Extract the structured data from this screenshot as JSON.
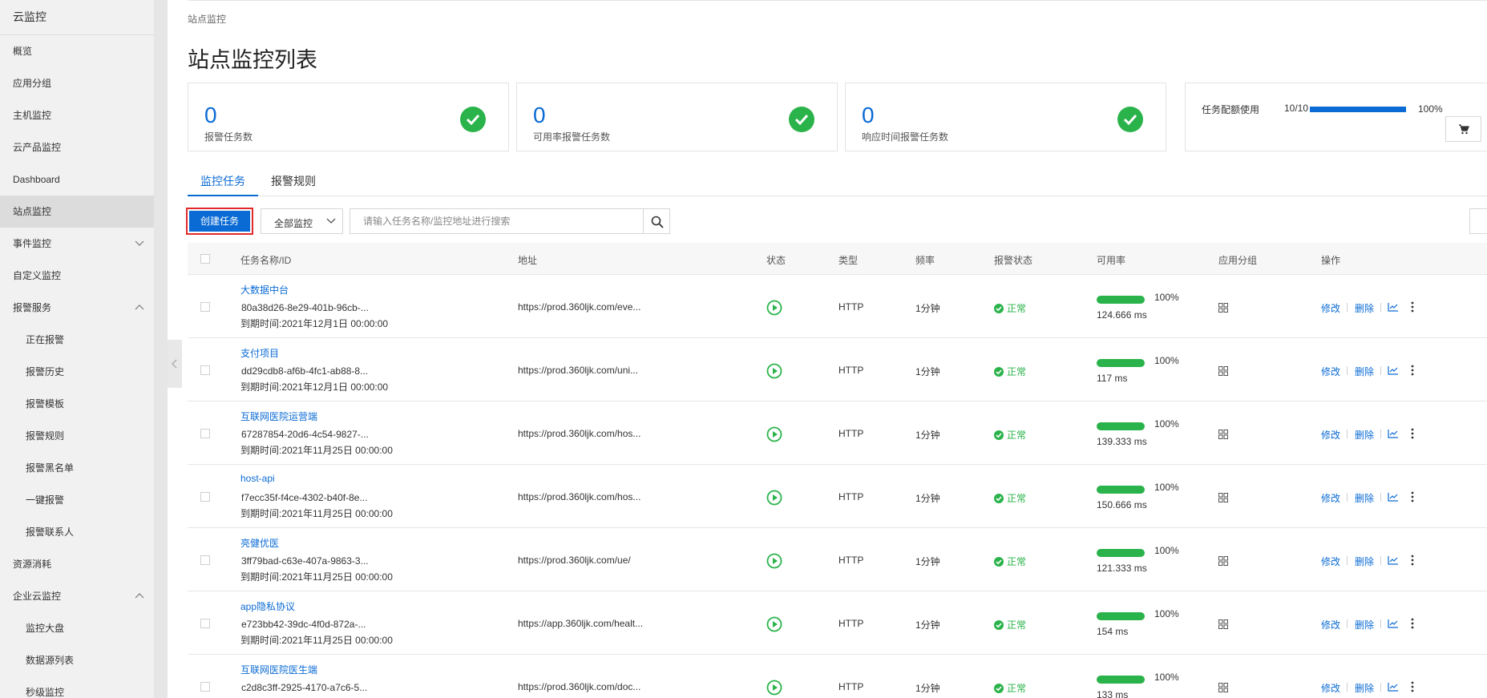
{
  "sidebar": {
    "title": "云监控",
    "items": [
      {
        "label": "概览",
        "sub": false
      },
      {
        "label": "应用分组",
        "sub": false
      },
      {
        "label": "主机监控",
        "sub": false
      },
      {
        "label": "云产品监控",
        "sub": false
      },
      {
        "label": "Dashboard",
        "sub": false
      },
      {
        "label": "站点监控",
        "sub": false,
        "active": true
      },
      {
        "label": "事件监控",
        "sub": false,
        "chevron": "down"
      },
      {
        "label": "自定义监控",
        "sub": false
      },
      {
        "label": "报警服务",
        "sub": false,
        "chevron": "up"
      },
      {
        "label": "正在报警",
        "sub": true
      },
      {
        "label": "报警历史",
        "sub": true
      },
      {
        "label": "报警模板",
        "sub": true
      },
      {
        "label": "报警规则",
        "sub": true
      },
      {
        "label": "报警黑名单",
        "sub": true
      },
      {
        "label": "一键报警",
        "sub": true
      },
      {
        "label": "报警联系人",
        "sub": true
      },
      {
        "label": "资源消耗",
        "sub": false
      },
      {
        "label": "企业云监控",
        "sub": false,
        "chevron": "up"
      },
      {
        "label": "监控大盘",
        "sub": true
      },
      {
        "label": "数据源列表",
        "sub": true
      },
      {
        "label": "秒级监控",
        "sub": true
      }
    ]
  },
  "breadcrumb": "站点监控",
  "page_title": "站点监控列表",
  "stats": [
    {
      "value": "0",
      "label": "报警任务数"
    },
    {
      "value": "0",
      "label": "可用率报警任务数"
    },
    {
      "value": "0",
      "label": "响应时间报警任务数"
    }
  ],
  "quota": {
    "label": "任务配额使用",
    "count": "10/10",
    "percent": "100%",
    "fill": 1.0
  },
  "tabs": [
    "监控任务",
    "报警规则"
  ],
  "toolbar": {
    "create_label": "创建任务",
    "filter_value": "全部监控",
    "search_placeholder": "请输入任务名称/监控地址进行搜索"
  },
  "table": {
    "headers": {
      "name": "任务名称/ID",
      "address": "地址",
      "status": "状态",
      "type": "类型",
      "freq": "频率",
      "alarm": "报警状态",
      "availability": "可用率",
      "group": "应用分组",
      "ops": "操作"
    },
    "rows": [
      {
        "name": "大数据中台",
        "id": "80a38d26-8e29-401b-96cb-...",
        "expire": "到期时间:2021年12月1日 00:00:00",
        "address": "https://prod.360ljk.com/eve...",
        "type": "HTTP",
        "freq": "1分钟",
        "alarm": "正常",
        "pct": "100%",
        "ms": "124.666 ms"
      },
      {
        "name": "支付项目",
        "id": "dd29cdb8-af6b-4fc1-ab88-8...",
        "expire": "到期时间:2021年12月1日 00:00:00",
        "address": "https://prod.360ljk.com/uni...",
        "type": "HTTP",
        "freq": "1分钟",
        "alarm": "正常",
        "pct": "100%",
        "ms": "117 ms"
      },
      {
        "name": "互联网医院运营端",
        "id": "67287854-20d6-4c54-9827-...",
        "expire": "到期时间:2021年11月25日 00:00:00",
        "address": "https://prod.360ljk.com/hos...",
        "type": "HTTP",
        "freq": "1分钟",
        "alarm": "正常",
        "pct": "100%",
        "ms": "139.333 ms"
      },
      {
        "name": "host-api",
        "id": "f7ecc35f-f4ce-4302-b40f-8e...",
        "expire": "到期时间:2021年11月25日 00:00:00",
        "address": "https://prod.360ljk.com/hos...",
        "type": "HTTP",
        "freq": "1分钟",
        "alarm": "正常",
        "pct": "100%",
        "ms": "150.666 ms"
      },
      {
        "name": "亮健优医",
        "id": "3ff79bad-c63e-407a-9863-3...",
        "expire": "到期时间:2021年11月25日 00:00:00",
        "address": "https://prod.360ljk.com/ue/",
        "type": "HTTP",
        "freq": "1分钟",
        "alarm": "正常",
        "pct": "100%",
        "ms": "121.333 ms"
      },
      {
        "name": "app隐私协议",
        "id": "e723bb42-39dc-4f0d-872a-...",
        "expire": "到期时间:2021年11月25日 00:00:00",
        "address": "https://app.360ljk.com/healt...",
        "type": "HTTP",
        "freq": "1分钟",
        "alarm": "正常",
        "pct": "100%",
        "ms": "154 ms"
      },
      {
        "name": "互联网医院医生端",
        "id": "c2d8c3ff-2925-4170-a7c6-5...",
        "expire": "",
        "address": "https://prod.360ljk.com/doc...",
        "type": "HTTP",
        "freq": "1分钟",
        "alarm": "正常",
        "pct": "100%",
        "ms": "133 ms"
      }
    ],
    "ops": {
      "edit": "修改",
      "delete": "删除"
    }
  },
  "colors": {
    "accent": "#0b6bd4",
    "success": "#2ab34a",
    "highlight": "#e0292b"
  }
}
